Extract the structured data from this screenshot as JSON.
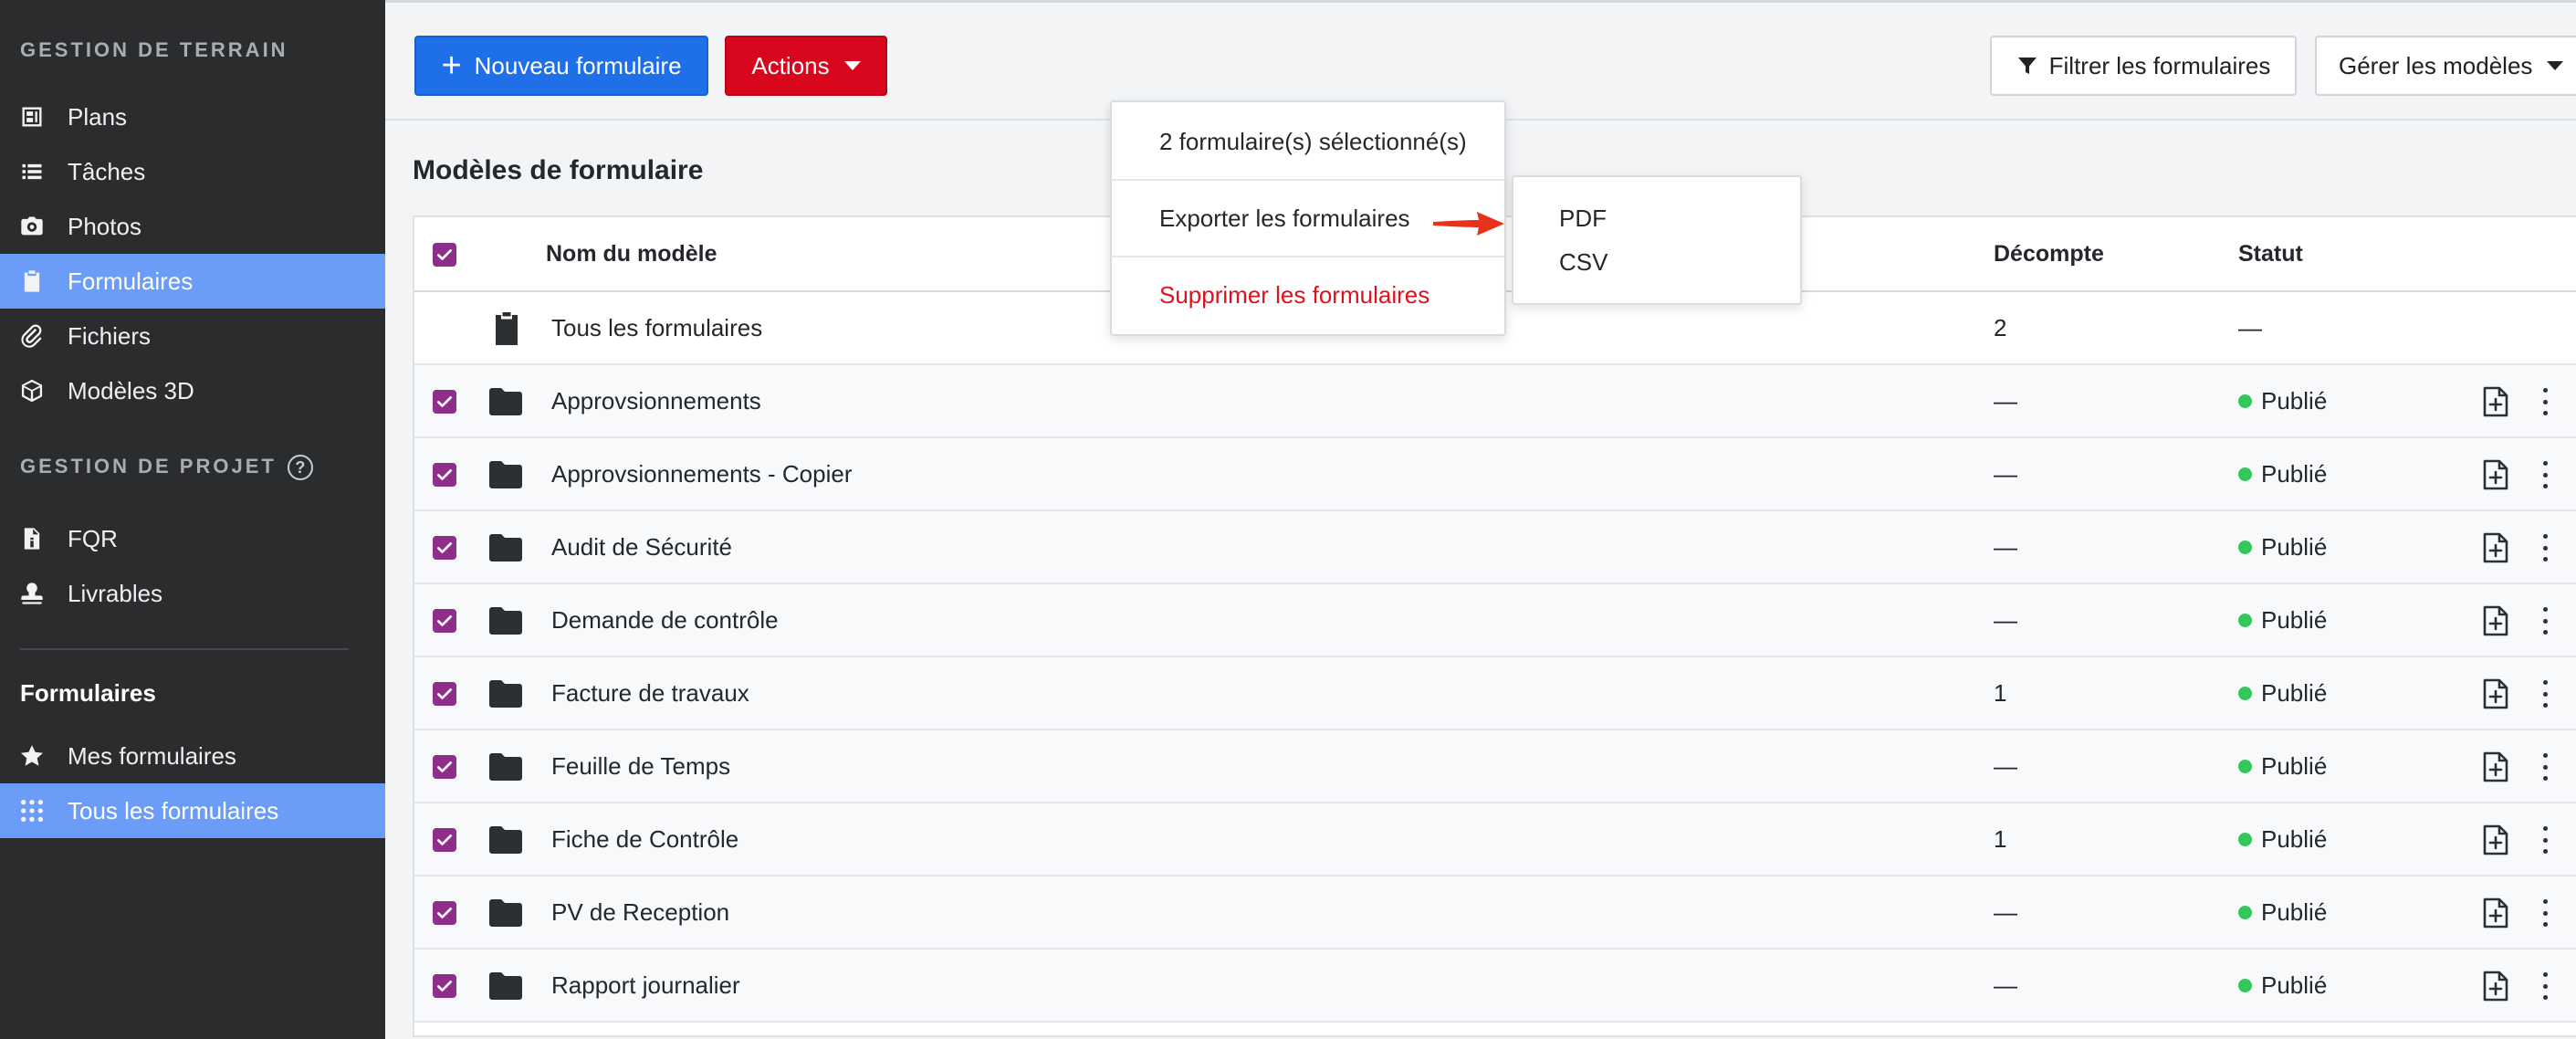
{
  "sidebar": {
    "section1_title": "GESTION DE TERRAIN",
    "section1_items": [
      {
        "label": "Plans",
        "icon": "plans-icon"
      },
      {
        "label": "Tâches",
        "icon": "list-icon"
      },
      {
        "label": "Photos",
        "icon": "camera-icon"
      },
      {
        "label": "Formulaires",
        "icon": "clipboard-icon",
        "active": true
      },
      {
        "label": "Fichiers",
        "icon": "paperclip-icon"
      },
      {
        "label": "Modèles 3D",
        "icon": "cube-icon"
      }
    ],
    "section2_title": "GESTION DE PROJET",
    "help_glyph": "?",
    "section2_items": [
      {
        "label": "FQR",
        "icon": "info-document-icon"
      },
      {
        "label": "Livrables",
        "icon": "stamp-icon"
      }
    ],
    "forms_heading": "Formulaires",
    "forms_items": [
      {
        "label": "Mes formulaires",
        "icon": "star-icon"
      },
      {
        "label": "Tous les formulaires",
        "icon": "grid-icon",
        "active": true
      }
    ]
  },
  "toolbar": {
    "new_form_label": "Nouveau formulaire",
    "new_form_glyph": "+",
    "actions_label": "Actions",
    "filter_label": "Filtrer les formulaires",
    "manage_label": "Gérer les modèles"
  },
  "page_title": "Modèles de formulaire",
  "actions_menu": {
    "selected_text": "2 formulaire(s) sélectionné(s)",
    "export_label": "Exporter les formulaires",
    "delete_label": "Supprimer les formulaires",
    "export_submenu": [
      "PDF",
      "CSV"
    ]
  },
  "table": {
    "headers": {
      "name": "Nom du modèle",
      "count": "Décompte",
      "status": "Statut"
    },
    "all_row": {
      "name": "Tous les formulaires",
      "count": "2",
      "status": "—"
    },
    "rows": [
      {
        "name": "Approvsionnements",
        "count": "—",
        "status": "Publié"
      },
      {
        "name": "Approvsionnements - Copier",
        "count": "—",
        "status": "Publié"
      },
      {
        "name": "Audit de Sécurité",
        "count": "—",
        "status": "Publié"
      },
      {
        "name": "Demande de contrôle",
        "count": "—",
        "status": "Publié"
      },
      {
        "name": "Facture de travaux",
        "count": "1",
        "status": "Publié"
      },
      {
        "name": "Feuille de Temps",
        "count": "—",
        "status": "Publié"
      },
      {
        "name": "Fiche de Contrôle",
        "count": "1",
        "status": "Publié"
      },
      {
        "name": "PV de Reception",
        "count": "—",
        "status": "Publié"
      },
      {
        "name": "Rapport journalier",
        "count": "—",
        "status": "Publié"
      }
    ]
  },
  "colors": {
    "sidebar_bg": "#2b2c2e",
    "active_nav": "#6b9cf7",
    "primary": "#1f6fe9",
    "danger": "#d9071e",
    "checkbox": "#8e2e8b",
    "published_dot": "#31c759",
    "arrow": "#e8321e"
  }
}
